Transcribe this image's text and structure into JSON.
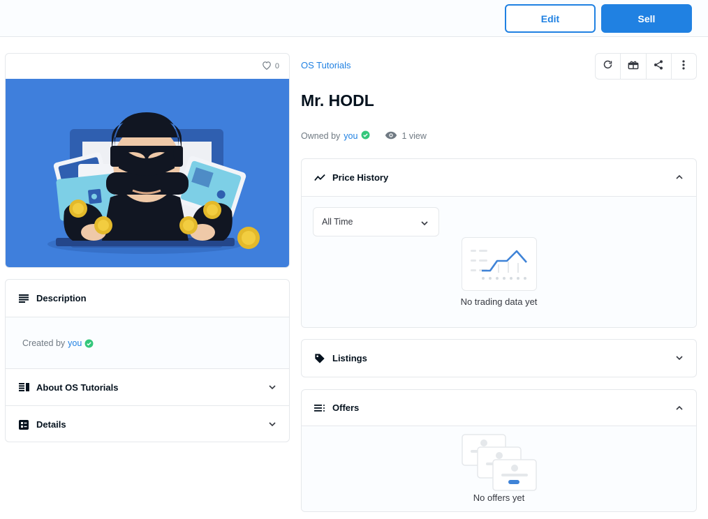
{
  "header": {
    "edit_label": "Edit",
    "sell_label": "Sell"
  },
  "media": {
    "favorites_count": "0"
  },
  "left_sections": {
    "description": {
      "title": "Description",
      "created_by_prefix": "Created by",
      "creator": "you"
    },
    "about": {
      "title": "About OS Tutorials"
    },
    "details": {
      "title": "Details"
    }
  },
  "item": {
    "collection": "OS Tutorials",
    "title": "Mr. HODL",
    "owned_by_prefix": "Owned by",
    "owner": "you",
    "views": "1 view"
  },
  "price_history": {
    "title": "Price History",
    "range_selected": "All Time",
    "empty_text": "No trading data yet"
  },
  "listings": {
    "title": "Listings"
  },
  "offers": {
    "title": "Offers",
    "empty_text": "No offers yet"
  },
  "colors": {
    "accent": "#2081e2",
    "verified": "#34c77b",
    "image_bg": "#3f7fdc"
  }
}
